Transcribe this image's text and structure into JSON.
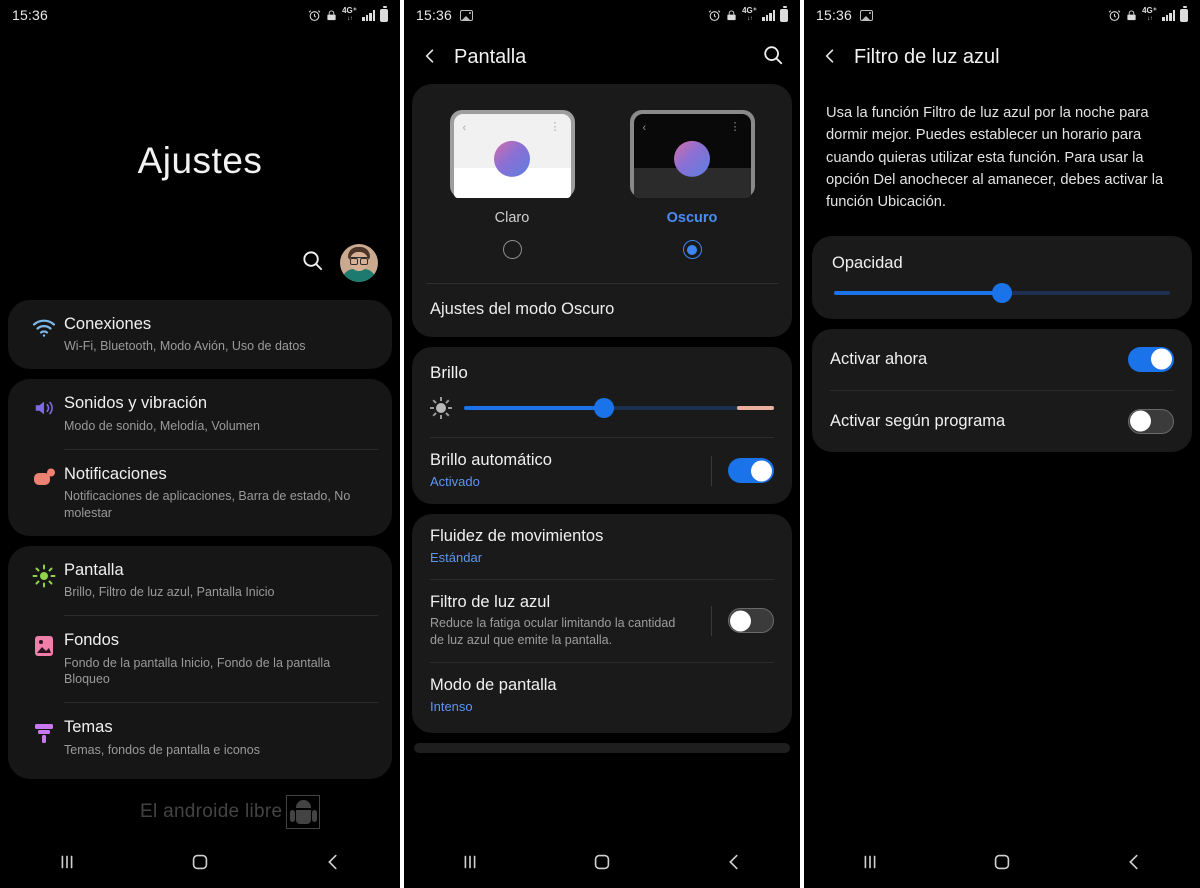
{
  "status_bar": {
    "time": "15:36",
    "icons": [
      "alarm-icon",
      "screen-lock-icon",
      "4g-plus-icon",
      "signal-bars-icon",
      "battery-icon"
    ],
    "screenshot_icon": "image-icon"
  },
  "panel1": {
    "title": "Ajustes",
    "search_icon": "search-icon",
    "avatar": "user-avatar",
    "groups": [
      {
        "items": [
          {
            "icon": "wifi-icon",
            "title": "Conexiones",
            "subtitle": "Wi-Fi, Bluetooth, Modo Avión, Uso de datos",
            "selected": true
          }
        ]
      },
      {
        "items": [
          {
            "icon": "sound-icon",
            "title": "Sonidos y vibración",
            "subtitle": "Modo de sonido, Melodía, Volumen",
            "selected": false
          },
          {
            "icon": "notification-icon",
            "title": "Notificaciones",
            "subtitle": "Notificaciones de aplicaciones, Barra de estado, No molestar",
            "selected": false
          }
        ]
      },
      {
        "items": [
          {
            "icon": "brightness-icon",
            "title": "Pantalla",
            "subtitle": "Brillo, Filtro de luz azul, Pantalla Inicio",
            "selected": false
          },
          {
            "icon": "wallpaper-icon",
            "title": "Fondos",
            "subtitle": "Fondo de la pantalla Inicio, Fondo de la pantalla Bloqueo",
            "selected": false
          },
          {
            "icon": "themes-icon",
            "title": "Temas",
            "subtitle": "Temas, fondos de pantalla e iconos",
            "selected": false
          }
        ]
      }
    ]
  },
  "panel2": {
    "header": {
      "back_icon": "back-chevron-icon",
      "title": "Pantalla",
      "search_icon": "search-icon"
    },
    "themes": {
      "light": {
        "label": "Claro",
        "selected": false
      },
      "dark": {
        "label": "Oscuro",
        "selected": true
      },
      "dark_settings_label": "Ajustes del modo Oscuro"
    },
    "brightness": {
      "title": "Brillo",
      "icon": "brightness-low-icon",
      "value_percent": 45,
      "warm_start_percent": 88
    },
    "auto_brightness": {
      "title": "Brillo automático",
      "status": "Activado",
      "toggle": "on"
    },
    "items": [
      {
        "title": "Fluidez de movimientos",
        "value": "Estándar"
      },
      {
        "title": "Filtro de luz azul",
        "subtitle": "Reduce la fatiga ocular limitando la cantidad de luz azul que emite la pantalla.",
        "toggle": "off"
      },
      {
        "title": "Modo de pantalla",
        "value": "Intenso"
      }
    ]
  },
  "panel3": {
    "header": {
      "back_icon": "back-chevron-icon",
      "title": "Filtro de luz azul"
    },
    "description": "Usa la función Filtro de luz azul por la noche para dormir mejor. Puedes establecer un horario para cuando quieras utilizar esta función. Para usar la opción Del anochecer al amanecer, debes activar la función Ubicación.",
    "opacity": {
      "title": "Opacidad",
      "value_percent": 50
    },
    "toggles": [
      {
        "title": "Activar ahora",
        "toggle": "on"
      },
      {
        "title": "Activar según programa",
        "toggle": "off"
      }
    ]
  },
  "navbar": {
    "recents_icon": "recents-icon",
    "home_icon": "home-icon",
    "back_icon": "back-icon"
  },
  "watermark": {
    "text": "El androide libre",
    "logo": "android-robot-icon"
  },
  "colors": {
    "accent_blue": "#1a73e8",
    "link_blue": "#5c96ef",
    "background": "#000000",
    "card": "#1a1a1a",
    "warm_slider": "#edb0a0"
  }
}
